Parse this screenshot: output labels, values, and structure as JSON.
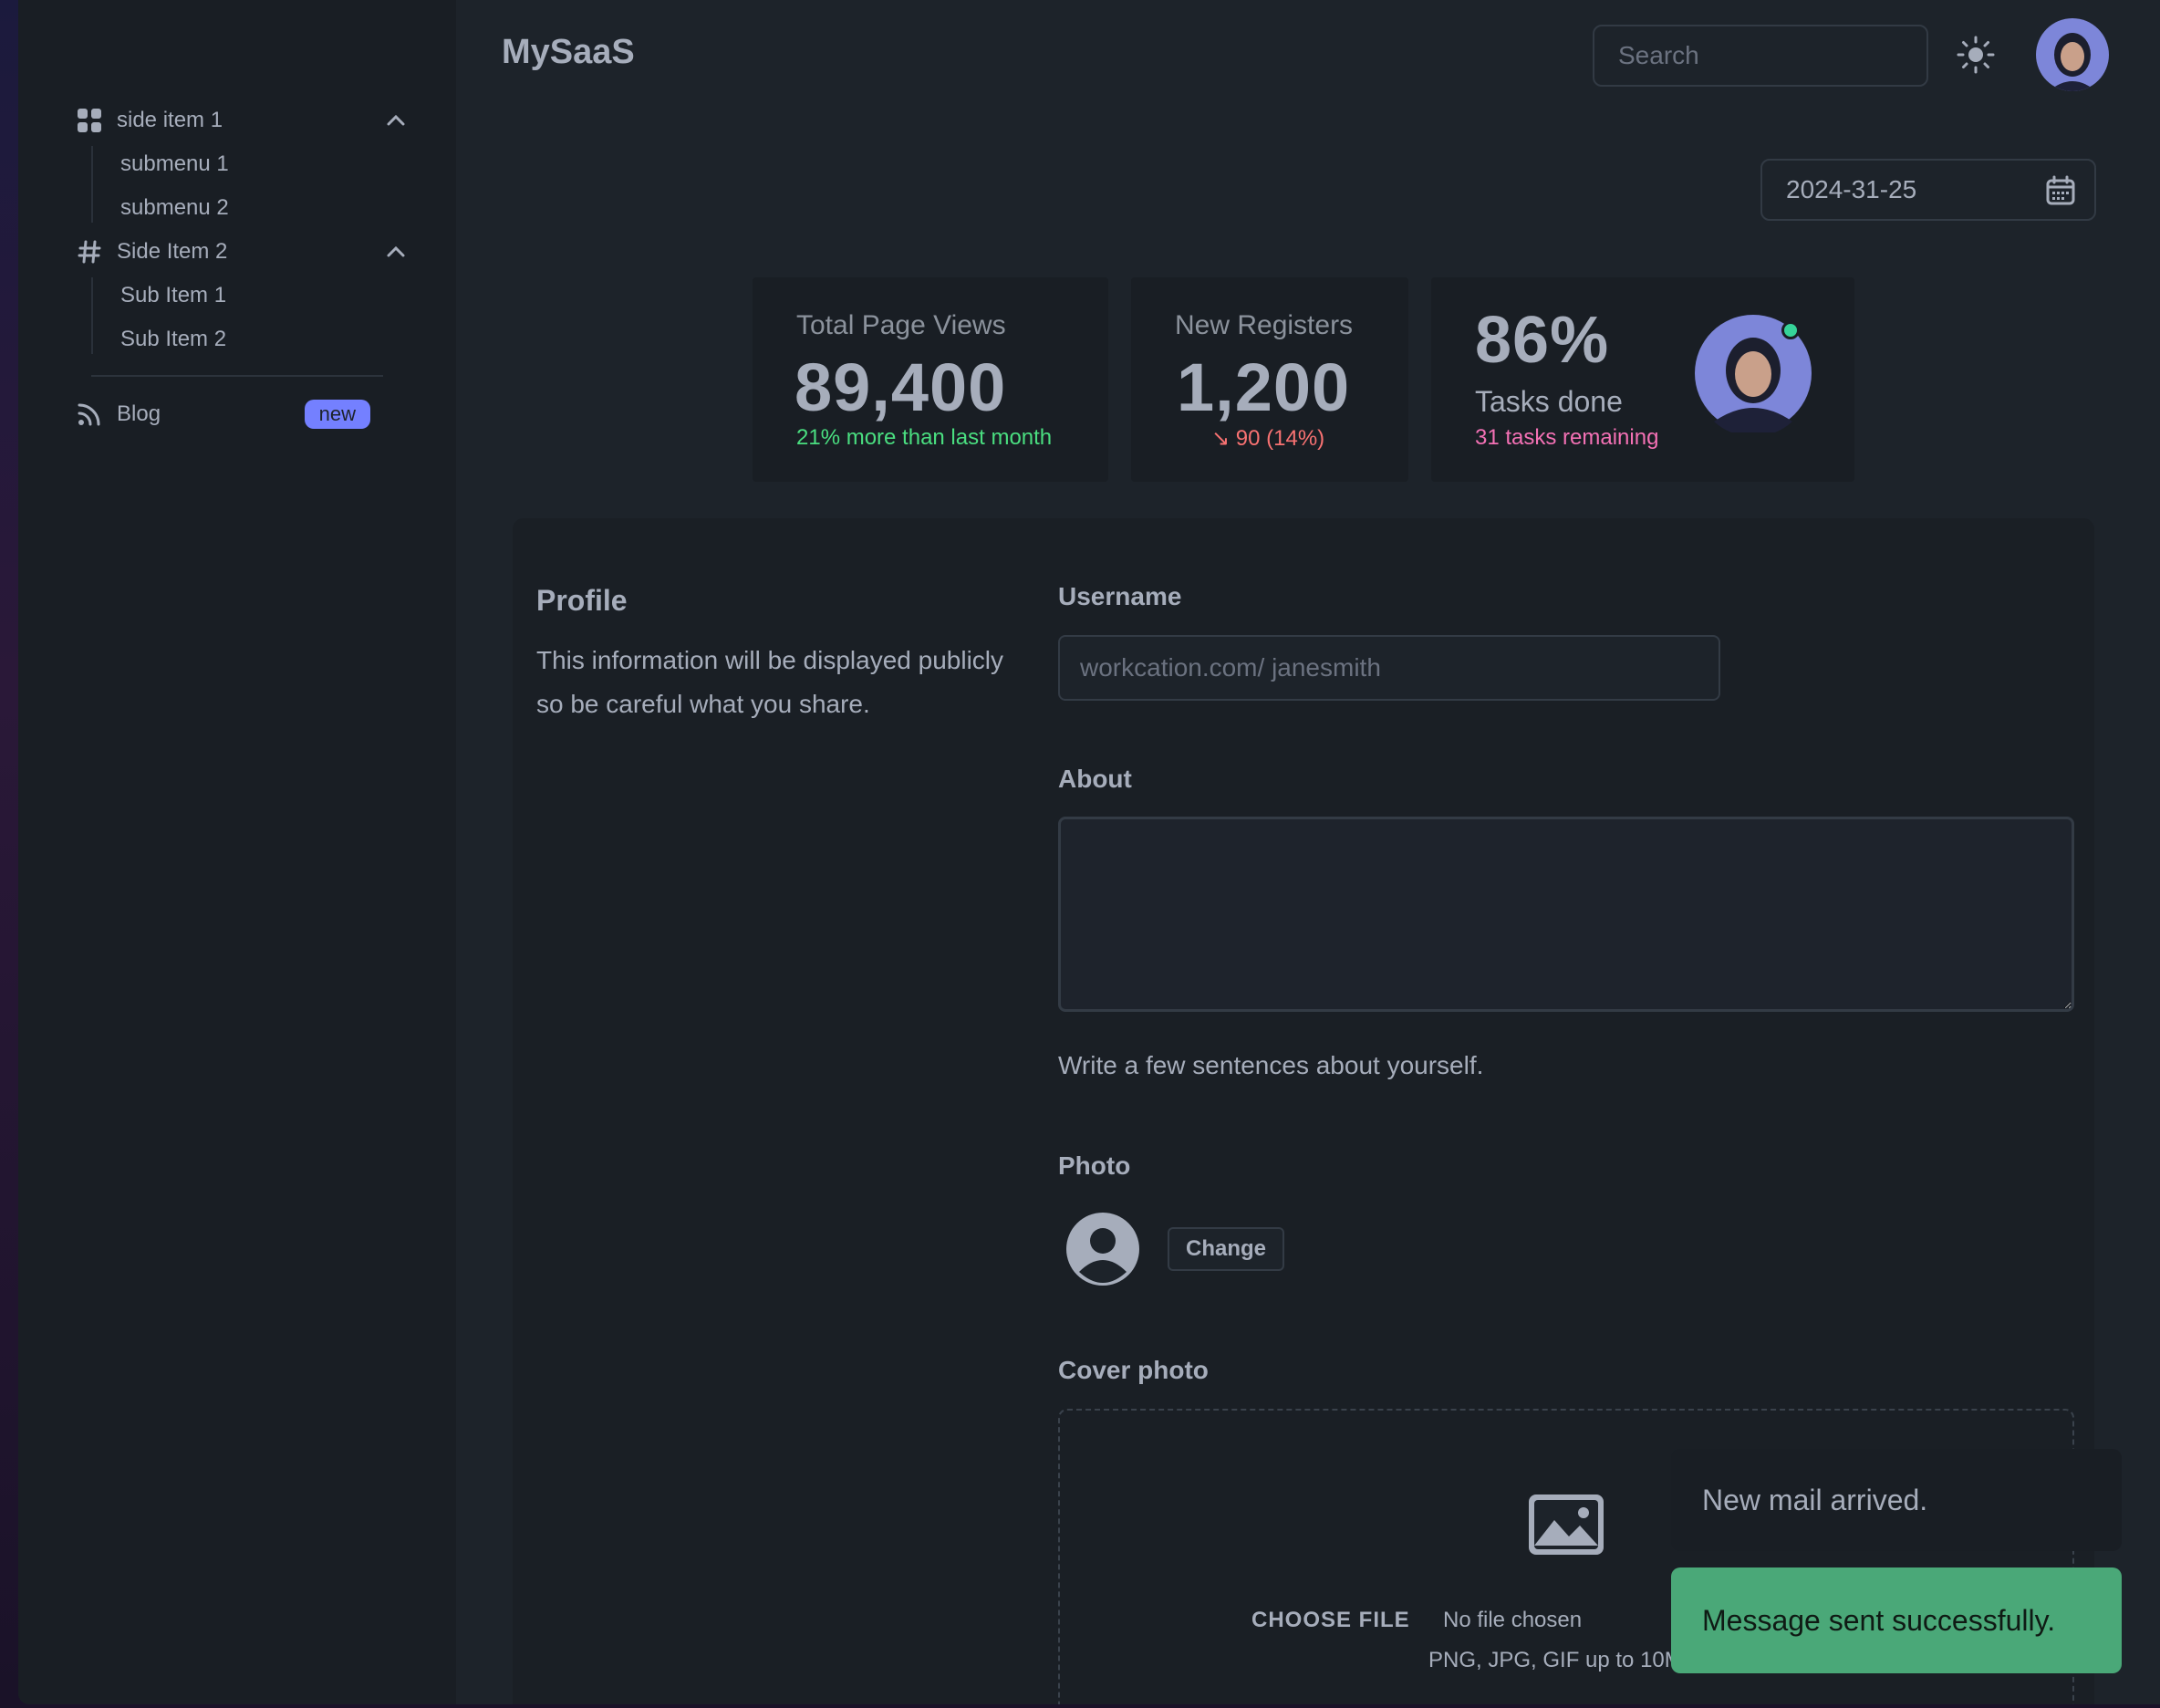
{
  "app": {
    "brand": "MySaaS"
  },
  "sidebar": {
    "groups": [
      {
        "label": "side item 1",
        "icon": "grid-icon",
        "items": [
          "submenu 1",
          "submenu 2"
        ]
      },
      {
        "label": "Side Item 2",
        "icon": "hash-icon",
        "items": [
          "Sub Item 1",
          "Sub Item 2"
        ]
      }
    ],
    "blog": {
      "label": "Blog",
      "icon": "rss-icon",
      "badge": "new"
    }
  },
  "header": {
    "search_placeholder": "Search",
    "theme_icon": "sun-icon"
  },
  "date": {
    "value": "2024-31-25",
    "icon": "calendar-icon"
  },
  "stats": {
    "page_views": {
      "title": "Total Page Views",
      "value": "89,400",
      "desc": "21% more than last month",
      "color": "#4ade80"
    },
    "registers": {
      "title": "New Registers",
      "value": "1,200",
      "desc": "↘ 90 (14%)",
      "color": "#f87272"
    },
    "tasks": {
      "value": "86%",
      "title": "Tasks done",
      "desc": "31 tasks remaining",
      "color": "#f471b5",
      "online_color": "#36d399"
    }
  },
  "profile": {
    "heading": "Profile",
    "description_line1": "This information will be displayed publicly",
    "description_line2": "so be careful what you share.",
    "username_label": "Username",
    "username_placeholder": "workcation.com/ janesmith",
    "about_label": "About",
    "about_hint": "Write a few sentences about yourself.",
    "photo_label": "Photo",
    "change_label": "Change",
    "cover_label": "Cover photo",
    "choose_file": "CHOOSE FILE",
    "no_file": "No file chosen",
    "file_hint": "PNG, JPG, GIF up to 10MB"
  },
  "toasts": {
    "info": "New mail arrived.",
    "success": "Message sent successfully.",
    "success_color": "#4aa878",
    "info_color": "#191e24"
  }
}
